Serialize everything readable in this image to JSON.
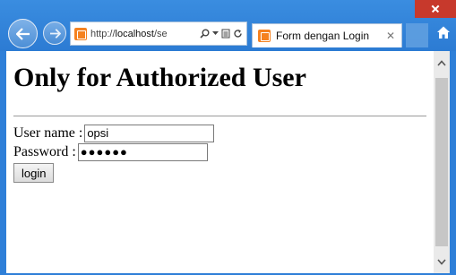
{
  "browser": {
    "url_prefix": "http://",
    "url_host": "localhost",
    "url_rest": "/se",
    "tab_title": "Form dengan Login",
    "tab_close": "✕"
  },
  "page": {
    "heading": "Only for Authorized User",
    "username_label": "User name : ",
    "username_value": "opsi",
    "password_label": "Password : ",
    "password_value": "●●●●●●",
    "login_button": "login"
  },
  "colors": {
    "chrome": "#2e7fd8",
    "close": "#c7392c"
  }
}
